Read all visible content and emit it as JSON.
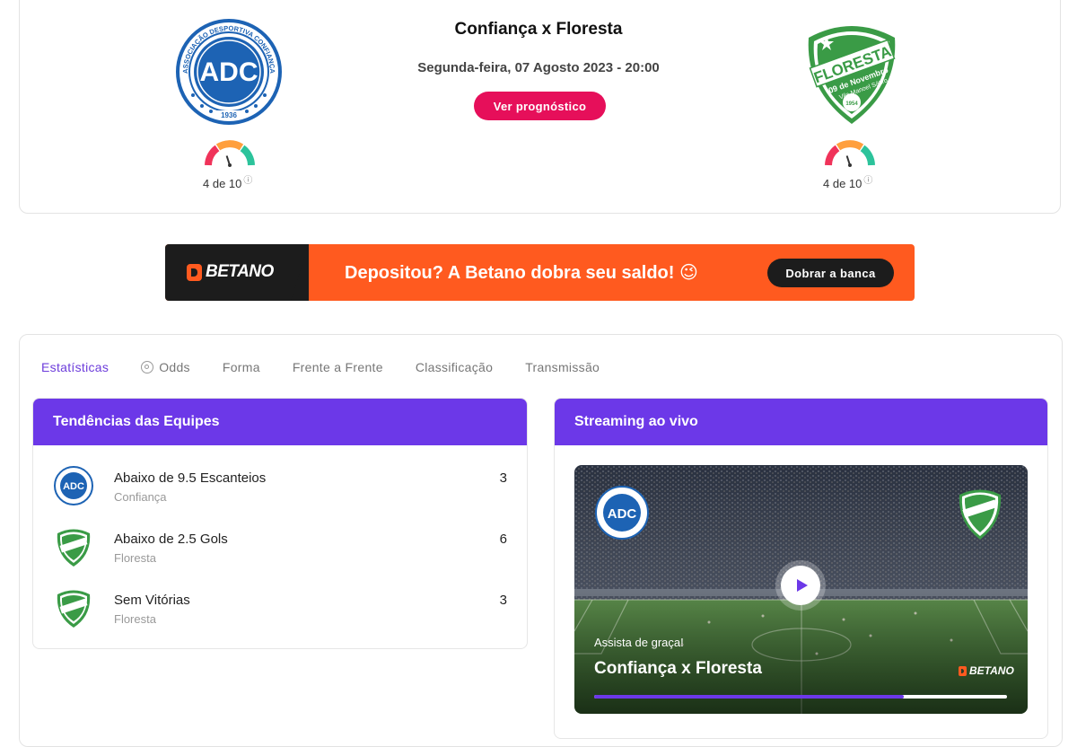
{
  "match": {
    "title": "Confiança x Floresta",
    "date": "Segunda-feira, 07 Agosto 2023 - 20:00",
    "prognostic_button": "Ver prognóstico",
    "home": {
      "name": "Confiança",
      "crest_text_top": "ASSOCIAÇÃO DESPORTIVA CONFIANÇA",
      "crest_initials": "ADC",
      "crest_year": "1936",
      "rating_text": "4 de 10",
      "rating_value": 4,
      "rating_max": 10
    },
    "away": {
      "name": "Floresta",
      "crest_name": "FLORESTA",
      "crest_sub": "09 de Novembro",
      "crest_sub2": "Vila Manoel Sátiro",
      "crest_year": "1954",
      "rating_text": "4 de 10",
      "rating_value": 4,
      "rating_max": 10
    }
  },
  "banner": {
    "brand": "BETANO",
    "text": "Depositou? A Betano dobra seu saldo! 😉",
    "button": "Dobrar a banca"
  },
  "tabs": [
    {
      "label": "Estatísticas",
      "active": true,
      "icon": ""
    },
    {
      "label": "Odds",
      "active": false,
      "icon": "odds-icon"
    },
    {
      "label": "Forma",
      "active": false,
      "icon": ""
    },
    {
      "label": "Frente a Frente",
      "active": false,
      "icon": ""
    },
    {
      "label": "Classificação",
      "active": false,
      "icon": ""
    },
    {
      "label": "Transmissão",
      "active": false,
      "icon": ""
    }
  ],
  "trends": {
    "title": "Tendências das Equipes",
    "rows": [
      {
        "label": "Abaixo de 9.5 Escanteios",
        "team": "Confiança",
        "count": "3",
        "crest": "home"
      },
      {
        "label": "Abaixo de 2.5 Gols",
        "team": "Floresta",
        "count": "6",
        "crest": "away"
      },
      {
        "label": "Sem Vitórias",
        "team": "Floresta",
        "count": "3",
        "crest": "away"
      }
    ]
  },
  "stream": {
    "title": "Streaming ao vivo",
    "subtitle": "Assista de graça!",
    "match_title": "Confiança x Floresta",
    "brand": "BETANO",
    "progress": 0.75
  },
  "colors": {
    "accent": "#6c38e8",
    "brand_pink": "#e60f5a",
    "betano_orange": "#ff5a1f",
    "home_blue": "#1d63b4",
    "away_green": "#3a9b46"
  }
}
